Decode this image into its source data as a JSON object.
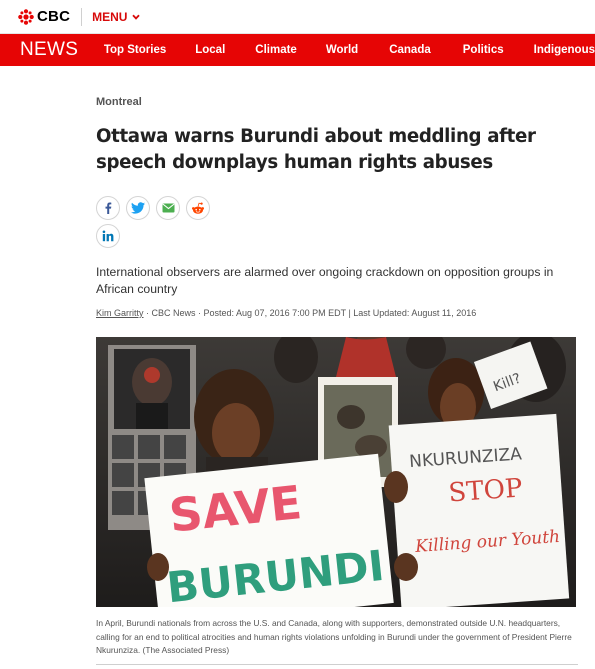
{
  "header": {
    "logo_text": "CBC",
    "menu_label": "MENU"
  },
  "nav": {
    "news_label": "NEWS",
    "links": [
      "Top Stories",
      "Local",
      "Climate",
      "World",
      "Canada",
      "Politics",
      "Indigenous"
    ]
  },
  "article": {
    "section": "Montreal",
    "headline": "Ottawa warns Burundi about meddling after speech downplays human rights abuses",
    "deck": "International observers are alarmed over ongoing crackdown on opposition groups in African country",
    "byline": {
      "author": "Kim Garritty",
      "rest": " · CBC News · Posted: Aug 07, 2016 7:00 PM EDT | Last Updated: August 11, 2016"
    },
    "share_icons": [
      "facebook-icon",
      "twitter-icon",
      "email-icon",
      "reddit-icon",
      "linkedin-icon"
    ],
    "photo": {
      "sign_left_line1": "SAVE",
      "sign_left_line2": "BURUNDI",
      "sign_right_line1": "NKURUNZIZA",
      "sign_right_line2": "STOP",
      "sign_right_line3": "Killing our Youth",
      "sign_small": "Kill?"
    },
    "caption": "In April, Burundi nationals from across the U.S. and Canada, along with supporters, demonstrated outside U.N. headquarters, calling for an end to political atrocities and human rights violations unfolding in Burundi under the government of President Pierre Nkurunziza. (The Associated Press)"
  },
  "colors": {
    "brand_red": "#e60505",
    "sign_pink": "#e8566e",
    "sign_green": "#2f9e7d",
    "sign_red_text": "#d0453c"
  }
}
